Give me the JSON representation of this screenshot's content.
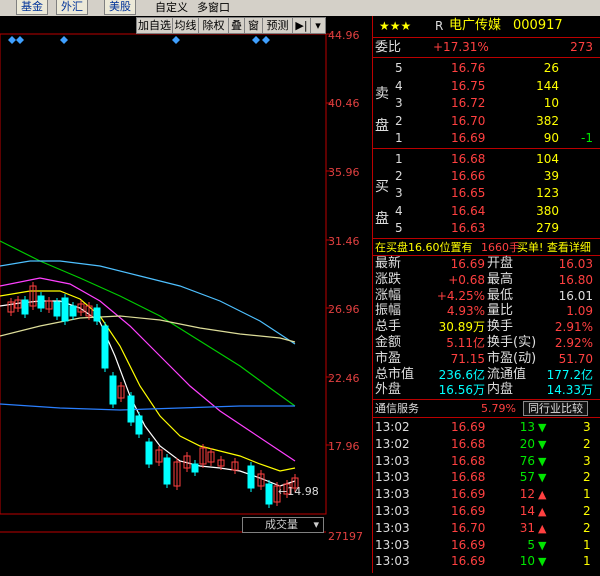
{
  "tabs": [
    "基金",
    "外汇",
    "美股"
  ],
  "toolbar": {
    "custom": "自定义",
    "multi": "多窗口"
  },
  "chart_tools": [
    "加自选",
    "均线",
    "除权",
    "叠",
    "窗",
    "预测"
  ],
  "yaxis": [
    "44.96",
    "40.46",
    "35.96",
    "31.46",
    "26.96",
    "22.46",
    "17.96",
    "27197"
  ],
  "annotation": "←14.98",
  "volume_label": "成交量",
  "stock": {
    "stars": "★★★",
    "flag": "R",
    "name": "电广传媒",
    "code": "000917"
  },
  "weibi": {
    "label": "委比",
    "value": "+17.31%",
    "diff": "273"
  },
  "sell_label": [
    "卖",
    "盘"
  ],
  "buy_label": [
    "买",
    "盘"
  ],
  "sell": [
    {
      "n": "5",
      "p": "16.76",
      "v": "26"
    },
    {
      "n": "4",
      "p": "16.75",
      "v": "144"
    },
    {
      "n": "3",
      "p": "16.72",
      "v": "10"
    },
    {
      "n": "2",
      "p": "16.70",
      "v": "382"
    },
    {
      "n": "1",
      "p": "16.69",
      "v": "90",
      "c": "-1"
    }
  ],
  "buy": [
    {
      "n": "1",
      "p": "16.68",
      "v": "104"
    },
    {
      "n": "2",
      "p": "16.66",
      "v": "39"
    },
    {
      "n": "3",
      "p": "16.65",
      "v": "123"
    },
    {
      "n": "4",
      "p": "16.64",
      "v": "380"
    },
    {
      "n": "5",
      "p": "16.63",
      "v": "279"
    }
  ],
  "notice": {
    "a": "在买盘16.60位置有",
    "b": "1660手",
    "c": "买单! 查看详细"
  },
  "stats": [
    {
      "l1": "最新",
      "v1": "16.69",
      "l2": "开盘",
      "v2": "16.03"
    },
    {
      "l1": "涨跌",
      "v1": "+0.68",
      "l2": "最高",
      "v2": "16.80"
    },
    {
      "l1": "涨幅",
      "v1": "+4.25%",
      "l2": "最低",
      "v2": "16.01"
    },
    {
      "l1": "振幅",
      "v1": "4.93%",
      "l2": "量比",
      "v2": "1.09"
    },
    {
      "l1": "总手",
      "v1": "30.89万",
      "l2": "换手",
      "v2": "2.91%"
    },
    {
      "l1": "金额",
      "v1": "5.11亿",
      "l2": "换手(实)",
      "v2": "2.92%"
    },
    {
      "l1": "市盈",
      "v1": "71.15",
      "l2": "市盈(动)",
      "v2": "51.70"
    },
    {
      "l1": "总市值",
      "v1": "236.6亿",
      "l2": "流通值",
      "v2": "177.2亿"
    },
    {
      "l1": "外盘",
      "v1": "16.56万",
      "l2": "内盘",
      "v2": "14.33万"
    }
  ],
  "industry": {
    "name": "通信服务",
    "pct": "5.79%",
    "btn": "同行业比较"
  },
  "ticks": [
    {
      "t": "13:02",
      "p": "16.69",
      "v": "13",
      "d": "down",
      "e": "3"
    },
    {
      "t": "13:02",
      "p": "16.68",
      "v": "20",
      "d": "down",
      "e": "2"
    },
    {
      "t": "13:03",
      "p": "16.68",
      "v": "76",
      "d": "down",
      "e": "3"
    },
    {
      "t": "13:03",
      "p": "16.68",
      "v": "57",
      "d": "down",
      "e": "2"
    },
    {
      "t": "13:03",
      "p": "16.69",
      "v": "12",
      "d": "up",
      "e": "1"
    },
    {
      "t": "13:03",
      "p": "16.69",
      "v": "14",
      "d": "up",
      "e": "2"
    },
    {
      "t": "13:03",
      "p": "16.70",
      "v": "31",
      "d": "up",
      "e": "2"
    },
    {
      "t": "13:03",
      "p": "16.69",
      "v": "5",
      "d": "down",
      "e": "1"
    },
    {
      "t": "13:03",
      "p": "16.69",
      "v": "10",
      "d": "down",
      "e": "1"
    }
  ]
}
